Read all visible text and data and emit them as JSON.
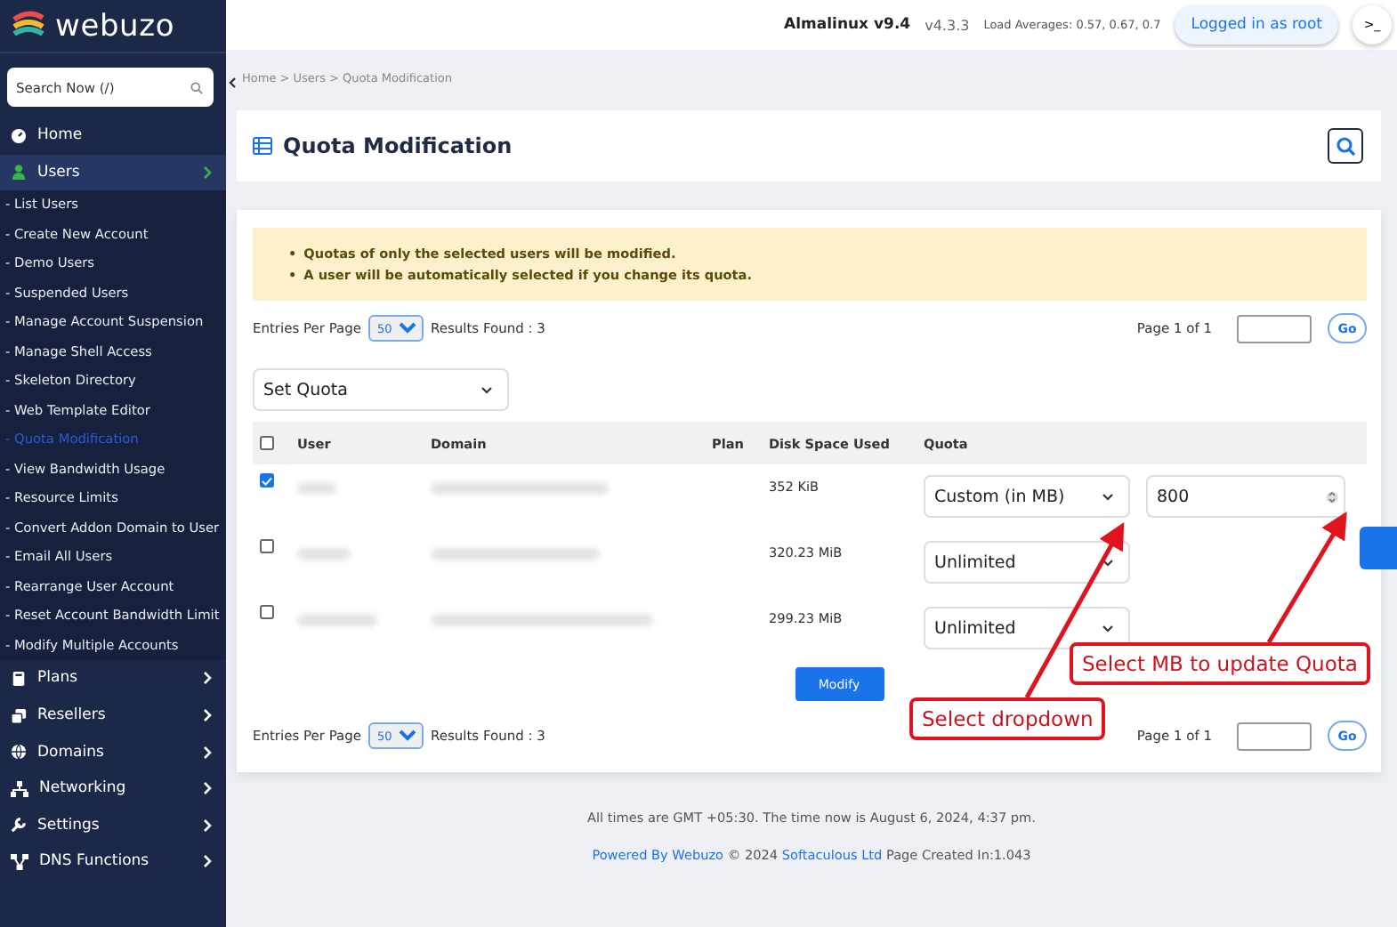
{
  "brand": "webuzo",
  "search": {
    "placeholder": "Search Now (/)"
  },
  "sidebar": {
    "items": [
      {
        "label": "Home",
        "selected": false,
        "has_arrow": false
      },
      {
        "label": "Users",
        "selected": true,
        "has_arrow": true,
        "children": [
          {
            "label": "- List Users",
            "selected": false
          },
          {
            "label": "- Create New Account",
            "selected": false
          },
          {
            "label": "- Demo Users",
            "selected": false
          },
          {
            "label": "- Suspended Users",
            "selected": false
          },
          {
            "label": "- Manage Account Suspension",
            "selected": false
          },
          {
            "label": "- Manage Shell Access",
            "selected": false
          },
          {
            "label": "- Skeleton Directory",
            "selected": false
          },
          {
            "label": "- Web Template Editor",
            "selected": false
          },
          {
            "label": "- Quota Modification",
            "selected": true
          },
          {
            "label": "- View Bandwidth Usage",
            "selected": false
          },
          {
            "label": "- Resource Limits",
            "selected": false
          },
          {
            "label": "- Convert Addon Domain to User",
            "selected": false
          },
          {
            "label": "- Email All Users",
            "selected": false
          },
          {
            "label": "- Rearrange User Account",
            "selected": false
          },
          {
            "label": "- Reset Account Bandwidth Limit",
            "selected": false
          },
          {
            "label": "- Modify Multiple Accounts",
            "selected": false
          }
        ]
      },
      {
        "label": "Plans",
        "selected": false,
        "has_arrow": true
      },
      {
        "label": "Resellers",
        "selected": false,
        "has_arrow": true
      },
      {
        "label": "Domains",
        "selected": false,
        "has_arrow": true
      },
      {
        "label": "Networking",
        "selected": false,
        "has_arrow": true
      },
      {
        "label": "Settings",
        "selected": false,
        "has_arrow": true
      },
      {
        "label": "DNS Functions",
        "selected": false,
        "has_arrow": true
      }
    ]
  },
  "topbar": {
    "os": "Almalinux v9.4",
    "version": "v4.3.3",
    "load": "Load Averages: 0.57, 0.67, 0.7",
    "user_button": "Logged in as root",
    "terminal": ">_"
  },
  "breadcrumb": "Home > Users > Quota Modification",
  "page_title": "Quota Modification",
  "notice": {
    "marker": "•",
    "items": [
      "Quotas of only the selected users will be modified.",
      "A user will be automatically selected if you change its quota."
    ]
  },
  "pager_top": {
    "entries_label": "Entries Per Page",
    "entries": "50",
    "results": "Results Found : 3",
    "page": "Page 1 of 1",
    "go": "Go"
  },
  "bulk_select": "Set Quota",
  "table": {
    "columns": [
      "User",
      "Domain",
      "Plan",
      "Disk Space Used",
      "Quota"
    ],
    "all_checked": false,
    "rows": [
      {
        "checked": true,
        "disk": "352 KiB",
        "quota": "Custom (in MB)",
        "custom_value": "800"
      },
      {
        "checked": false,
        "disk": "320.23 MiB",
        "quota": "Unlimited"
      },
      {
        "checked": false,
        "disk": "299.23 MiB",
        "quota": "Unlimited"
      }
    ]
  },
  "modify_button": "Modify",
  "pager_bottom": {
    "entries_label": "Entries Per Page",
    "entries": "50",
    "results": "Results Found : 3",
    "page": "Page 1 of 1",
    "go": "Go"
  },
  "footer": {
    "time": "All times are GMT +05:30. The time now is August 6, 2024, 4:37 pm.",
    "powered": "Powered By Webuzo",
    "copyright": "© 2024",
    "company": "Softaculous Ltd",
    "created": "Page Created In:1.043"
  },
  "annotations": [
    {
      "kind": "dropdown",
      "text": "Select dropdown"
    },
    {
      "kind": "value",
      "text": "Select MB to update Quota"
    }
  ]
}
